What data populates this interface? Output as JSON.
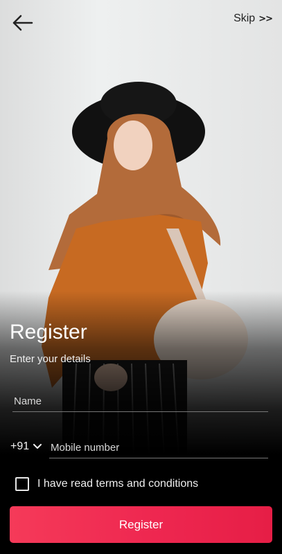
{
  "header": {
    "back_icon": "arrow-left-icon",
    "skip_label": "Skip",
    "skip_icon": "double-chevron-right-icon"
  },
  "form": {
    "title": "Register",
    "subtitle": "Enter your details",
    "name_placeholder": "Name",
    "country_code": "+91",
    "country_icon": "chevron-down-icon",
    "mobile_placeholder": "Mobile number",
    "terms_label": "I have read terms and conditions",
    "terms_checked": false,
    "submit_label": "Register"
  },
  "colors": {
    "accent": "#ee2750",
    "background": "#000000",
    "text": "#ffffff"
  }
}
